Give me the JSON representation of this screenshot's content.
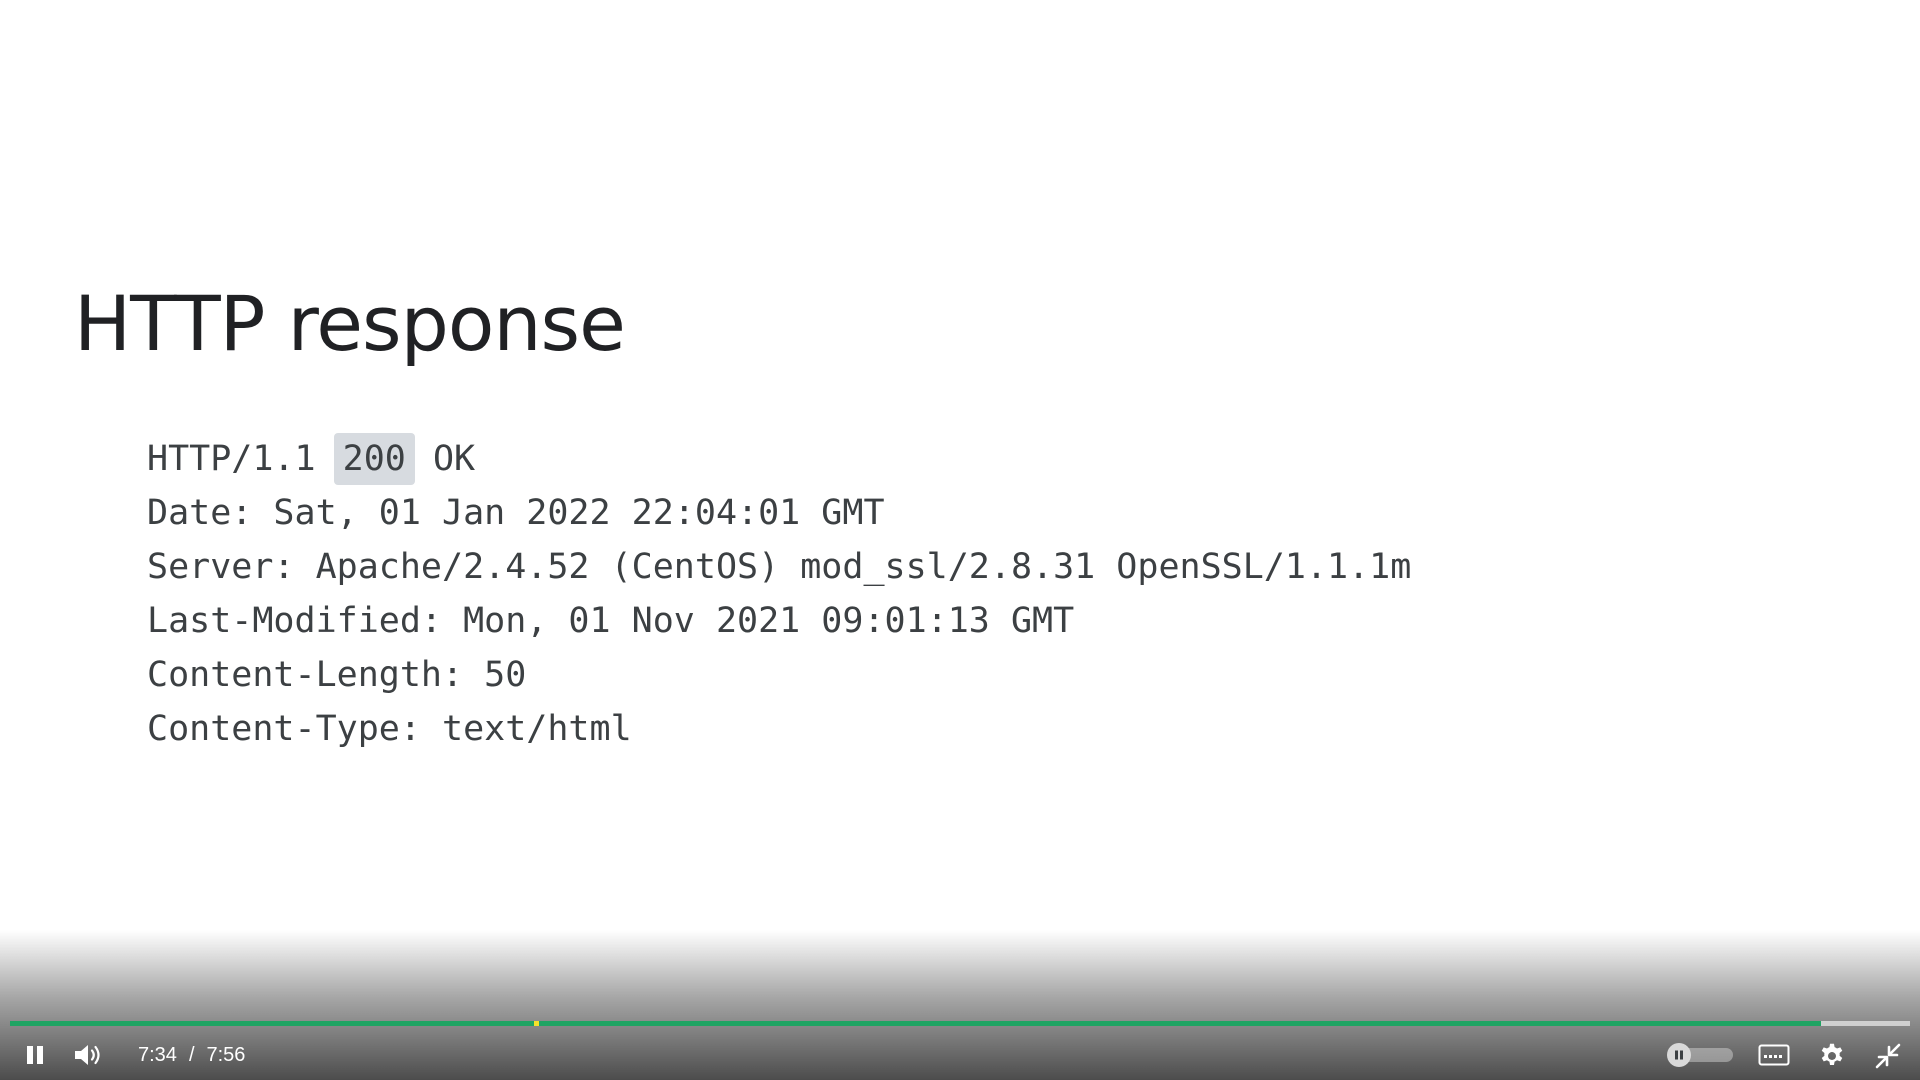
{
  "slide": {
    "title": "HTTP response",
    "response_lines": [
      {
        "before": "HTTP/1.1 ",
        "highlight": "200",
        "after": " OK"
      },
      "Date: Sat, 01 Jan 2022 22:04:01 GMT",
      "Server: Apache/2.4.52 (CentOS) mod_ssl/2.8.31 OpenSSL/1.1.1m",
      "Last-Modified: Mon, 01 Nov 2021 09:01:13 GMT",
      "Content-Length: 50",
      "Content-Type: text/html"
    ],
    "highlight_color": "#d7dbe0"
  },
  "player": {
    "current_time": "7:34",
    "separator": "/",
    "duration": "7:56",
    "played_fraction": 0.953,
    "marker_fraction": 0.276,
    "colors": {
      "played": "#1fa463",
      "marker": "#f6e12b"
    },
    "icons": {
      "play_pause": "pause-icon",
      "volume": "volume-icon",
      "autoplay": "autoplay-toggle",
      "captions": "captions-icon",
      "settings": "gear-icon",
      "fullscreen": "exit-fullscreen-icon"
    }
  }
}
